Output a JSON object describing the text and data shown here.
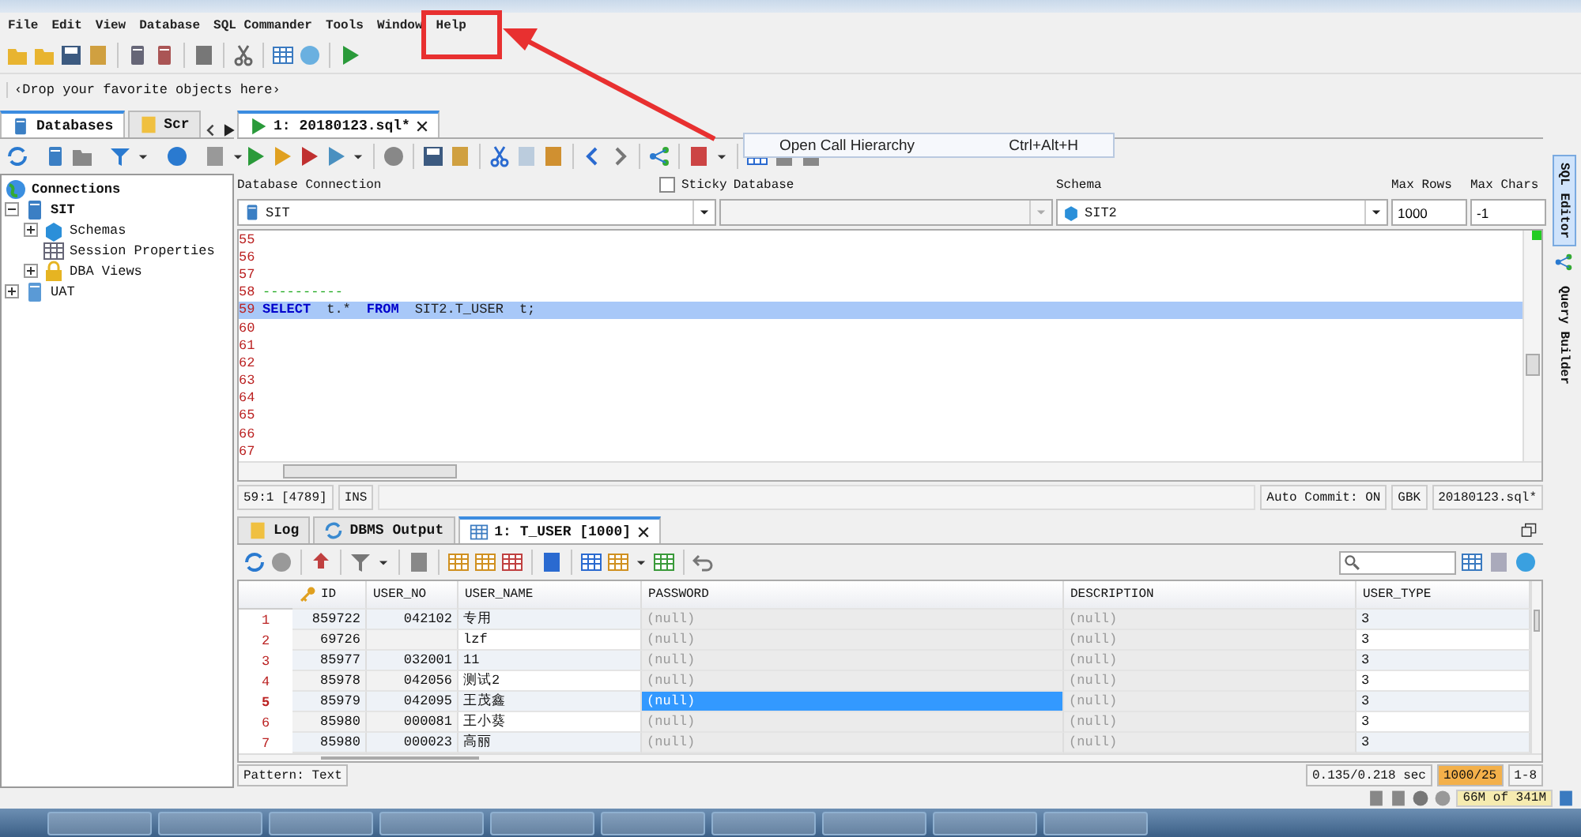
{
  "menu": [
    "File",
    "Edit",
    "View",
    "Database",
    "SQL Commander",
    "Tools",
    "Window",
    "Help"
  ],
  "favorites_bar": {
    "text": "‹Drop your favorite objects here›"
  },
  "left_tabs": [
    {
      "label": "Databases",
      "selected": true
    },
    {
      "label": "Scr",
      "selected": false
    }
  ],
  "tree": {
    "label": "Connections",
    "children": [
      {
        "label": "SIT",
        "kind": "connection",
        "connected": true,
        "expanded": true,
        "children": [
          {
            "label": "Schemas",
            "kind": "schemas",
            "expanded": false
          },
          {
            "label": "Session Properties",
            "kind": "properties"
          },
          {
            "label": "DBA Views",
            "kind": "views",
            "expanded": false
          }
        ]
      },
      {
        "label": "UAT",
        "kind": "connection",
        "connected": false,
        "expanded": false
      }
    ]
  },
  "editor_tabs": [
    {
      "label": "1: 20180123.sql*",
      "selected": true
    }
  ],
  "tooltip": {
    "label": "Open Call Hierarchy",
    "shortcut": "Ctrl+Alt+H"
  },
  "connection": {
    "connection_label": "Database Connection",
    "connection": "SIT",
    "sticky": {
      "label": "Sticky",
      "checked": false
    },
    "database_label": "Database",
    "schema_label": "Schema",
    "schema": "SIT2",
    "max_rows_label": "Max Rows",
    "max_rows": "1000",
    "max_chars_label": "Max Chars",
    "max_chars": "-1"
  },
  "editor_lines": [
    {
      "number": "55",
      "current": false
    },
    {
      "number": "56",
      "current": false
    },
    {
      "number": "57",
      "current": false
    },
    {
      "number": "58",
      "current": false,
      "tokens": [
        {
          "text": "----------",
          "kind": "comment"
        }
      ]
    },
    {
      "number": "59",
      "current": true,
      "tokens": [
        {
          "text": "SELECT",
          "kind": "keyword"
        },
        {
          "text": "t.*",
          "kind": "plain"
        },
        {
          "text": "FROM",
          "kind": "keyword"
        },
        {
          "text": "SIT2.T_USER",
          "kind": "plain"
        },
        {
          "text": "t;",
          "kind": "plain"
        }
      ]
    },
    {
      "number": "60",
      "current": false
    },
    {
      "number": "61",
      "current": false
    },
    {
      "number": "62",
      "current": false
    },
    {
      "number": "63",
      "current": false
    },
    {
      "number": "64",
      "current": false
    },
    {
      "number": "65",
      "current": false
    },
    {
      "number": "66",
      "current": false
    },
    {
      "number": "67",
      "current": false
    }
  ],
  "editor_status": {
    "position": "59:1 [4789]",
    "mode": "INS",
    "auto_commit": "Auto Commit: ON",
    "encoding": "GBK",
    "file": "20180123.sql*"
  },
  "result_tabs": [
    {
      "label": "Log",
      "kind": "log",
      "selected": false
    },
    {
      "label": "DBMS Output",
      "kind": "output",
      "selected": false
    },
    {
      "label": "1: T_USER [1000]",
      "kind": "table",
      "selected": true
    }
  ],
  "grid": {
    "columns": [
      "ID",
      "USER_NO",
      "USER_NAME",
      "PASSWORD",
      "DESCRIPTION",
      "USER_TYPE"
    ],
    "rows": [
      {
        "number": "1",
        "selected": false,
        "cells": [
          {
            "text": "859722",
            "kind": "value",
            "selected": false
          },
          {
            "text": "042102",
            "kind": "value",
            "selected": false
          },
          {
            "text": "专用",
            "kind": "value",
            "selected": false
          },
          {
            "text": "(null)",
            "kind": "null",
            "selected": false
          },
          {
            "text": "(null)",
            "kind": "null",
            "selected": false
          },
          {
            "text": "3",
            "kind": "value",
            "selected": false
          }
        ]
      },
      {
        "number": "2",
        "selected": false,
        "cells": [
          {
            "text": "69726",
            "kind": "value",
            "selected": false
          },
          {
            "kind": "blank",
            "selected": false
          },
          {
            "text": "lzf",
            "kind": "value",
            "selected": false
          },
          {
            "text": "(null)",
            "kind": "null",
            "selected": false
          },
          {
            "text": "(null)",
            "kind": "null",
            "selected": false
          },
          {
            "text": "3",
            "kind": "value",
            "selected": false
          }
        ]
      },
      {
        "number": "3",
        "selected": false,
        "cells": [
          {
            "text": "85977",
            "kind": "value",
            "selected": false
          },
          {
            "text": "032001",
            "kind": "value",
            "selected": false
          },
          {
            "text": "11",
            "kind": "value",
            "selected": false
          },
          {
            "text": "(null)",
            "kind": "null",
            "selected": false
          },
          {
            "text": "(null)",
            "kind": "null",
            "selected": false
          },
          {
            "text": "3",
            "kind": "value",
            "selected": false
          }
        ]
      },
      {
        "number": "4",
        "selected": false,
        "cells": [
          {
            "text": "85978",
            "kind": "value",
            "selected": false
          },
          {
            "text": "042056",
            "kind": "value",
            "selected": false
          },
          {
            "text": "测试2",
            "kind": "value",
            "selected": false
          },
          {
            "text": "(null)",
            "kind": "null",
            "selected": false
          },
          {
            "text": "(null)",
            "kind": "null",
            "selected": false
          },
          {
            "text": "3",
            "kind": "value",
            "selected": false
          }
        ]
      },
      {
        "number": "5",
        "selected": true,
        "cells": [
          {
            "text": "85979",
            "kind": "value",
            "selected": false
          },
          {
            "text": "042095",
            "kind": "value",
            "selected": false
          },
          {
            "text": "王茂鑫",
            "kind": "value",
            "selected": false
          },
          {
            "text": "(null)",
            "kind": "null",
            "selected": true
          },
          {
            "text": "(null)",
            "kind": "null",
            "selected": false
          },
          {
            "text": "3",
            "kind": "value",
            "selected": false
          }
        ]
      },
      {
        "number": "6",
        "selected": false,
        "cells": [
          {
            "text": "85980",
            "kind": "value",
            "selected": false
          },
          {
            "text": "000081",
            "kind": "value",
            "selected": false
          },
          {
            "text": "王小葵",
            "kind": "value",
            "selected": false
          },
          {
            "text": "(null)",
            "kind": "null",
            "selected": false
          },
          {
            "text": "(null)",
            "kind": "null",
            "selected": false
          },
          {
            "text": "3",
            "kind": "value",
            "selected": false
          }
        ]
      },
      {
        "number": "7",
        "selected": false,
        "cells": [
          {
            "text": "85980",
            "kind": "value",
            "selected": false
          },
          {
            "text": "000023",
            "kind": "value",
            "selected": false
          },
          {
            "text": "高丽",
            "kind": "value",
            "selected": false
          },
          {
            "text": "(null)",
            "kind": "null",
            "selected": false
          },
          {
            "text": "(null)",
            "kind": "null",
            "selected": false
          },
          {
            "text": "3",
            "kind": "value",
            "selected": false
          }
        ]
      }
    ]
  },
  "result_status": {
    "pattern": "Pattern: Text",
    "timing": "0.135/0.218 sec",
    "row_count": "1000/25",
    "range": "1-8",
    "memory": "66M of 341M"
  },
  "side_tabs": [
    {
      "label": "SQL Editor",
      "selected": true
    },
    {
      "label": "Query Builder",
      "selected": false
    }
  ]
}
